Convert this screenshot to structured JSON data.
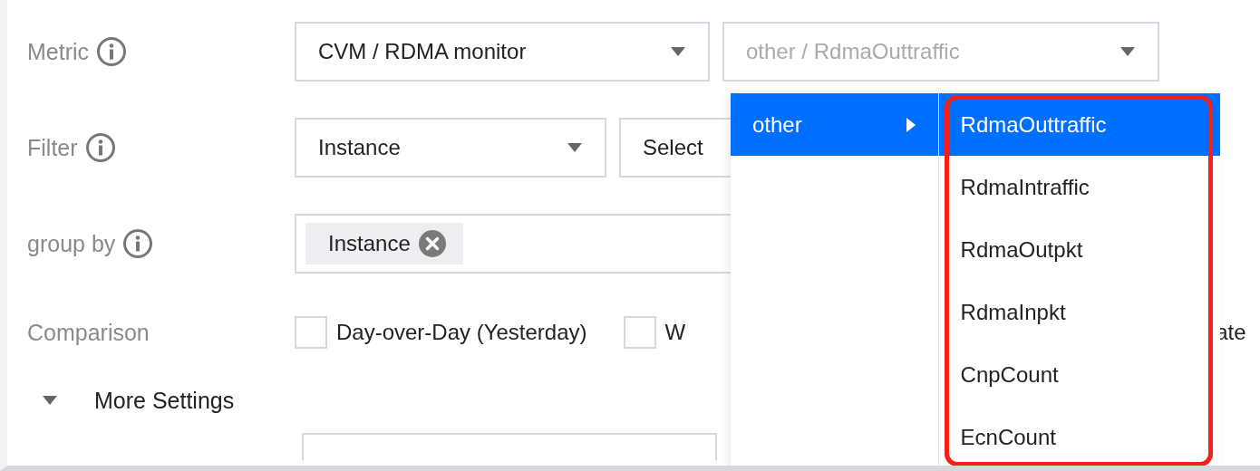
{
  "metric": {
    "label": "Metric",
    "category": "CVM / RDMA monitor",
    "placeholder": "other / RdmaOuttraffic"
  },
  "filter": {
    "label": "Filter",
    "field": "Instance",
    "value": "Select"
  },
  "group_by": {
    "label": "group by",
    "tags": [
      {
        "label": "Instance"
      }
    ]
  },
  "comparison": {
    "label": "Comparison",
    "options": [
      {
        "label": "Day-over-Day (Yesterday)",
        "checked": false
      },
      {
        "label": "W",
        "checked": false
      }
    ],
    "trailing_text": "ate"
  },
  "more_settings": {
    "label": "More Settings",
    "expanded": true
  },
  "cascader": {
    "columns": [
      {
        "highlighted": false,
        "items": [
          {
            "label": "other",
            "selected": true,
            "has_children": true
          }
        ]
      },
      {
        "highlighted": true,
        "items": [
          {
            "label": "RdmaOuttraffic",
            "selected": true,
            "has_children": false
          },
          {
            "label": "RdmaIntraffic",
            "selected": false,
            "has_children": false
          },
          {
            "label": "RdmaOutpkt",
            "selected": false,
            "has_children": false
          },
          {
            "label": "RdmaInpkt",
            "selected": false,
            "has_children": false
          },
          {
            "label": "CnpCount",
            "selected": false,
            "has_children": false
          },
          {
            "label": "EcnCount",
            "selected": false,
            "has_children": false
          }
        ]
      }
    ]
  }
}
